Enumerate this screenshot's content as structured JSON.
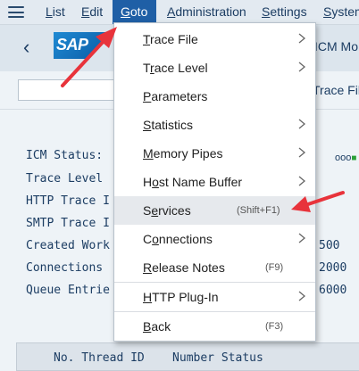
{
  "menubar": {
    "items": [
      {
        "label": "List",
        "accel": "L",
        "rest": "ist"
      },
      {
        "label": "Edit",
        "accel": "E",
        "rest": "dit"
      },
      {
        "label": "Goto",
        "accel": "G",
        "rest": "oto"
      },
      {
        "label": "Administration",
        "accel": "A",
        "rest": "dministration"
      },
      {
        "label": "Settings",
        "accel": "S",
        "rest": "ettings"
      },
      {
        "label": "System",
        "accel": "S",
        "rest": "ystem"
      }
    ]
  },
  "header": {
    "logo": "SAP",
    "title_fragment": "ICM Mo"
  },
  "toolbar": {
    "right_fragment": "Trace Fil"
  },
  "main": {
    "labels": [
      "ICM Status:",
      "Trace Level",
      "HTTP Trace I",
      "SMTP Trace I",
      "Created Work",
      "Connections",
      "Queue Entrie"
    ],
    "values": [
      "500",
      "2000",
      "6000"
    ],
    "status_icon": "ooo",
    "table_header": "No. Thread ID    Number Status"
  },
  "goto_menu": {
    "items": [
      {
        "pre": "",
        "accel": "T",
        "post": "race File",
        "submenu": true,
        "shortcut": ""
      },
      {
        "pre": "T",
        "accel": "r",
        "post": "ace Level",
        "submenu": true,
        "shortcut": ""
      },
      {
        "pre": "",
        "accel": "P",
        "post": "arameters",
        "submenu": false,
        "shortcut": ""
      },
      {
        "pre": "",
        "accel": "S",
        "post": "tatistics",
        "submenu": true,
        "shortcut": ""
      },
      {
        "pre": "",
        "accel": "M",
        "post": "emory Pipes",
        "submenu": true,
        "shortcut": ""
      },
      {
        "pre": "H",
        "accel": "o",
        "post": "st Name Buffer",
        "submenu": true,
        "shortcut": ""
      },
      {
        "pre": "S",
        "accel": "e",
        "post": "rvices",
        "submenu": false,
        "shortcut": "(Shift+F1)"
      },
      {
        "pre": "C",
        "accel": "o",
        "post": "nnections",
        "submenu": true,
        "shortcut": ""
      },
      {
        "pre": "",
        "accel": "R",
        "post": "elease Notes",
        "submenu": false,
        "shortcut": "(F9)"
      },
      {
        "pre": "",
        "accel": "H",
        "post": "TTP Plug-In",
        "submenu": true,
        "shortcut": ""
      },
      {
        "pre": "",
        "accel": "B",
        "post": "ack",
        "submenu": false,
        "shortcut": "(F3)"
      }
    ]
  },
  "colors": {
    "menu_active": "#1f5fa6",
    "annotation_arrow": "#e8333b",
    "highlight": "#e6e9ed"
  }
}
